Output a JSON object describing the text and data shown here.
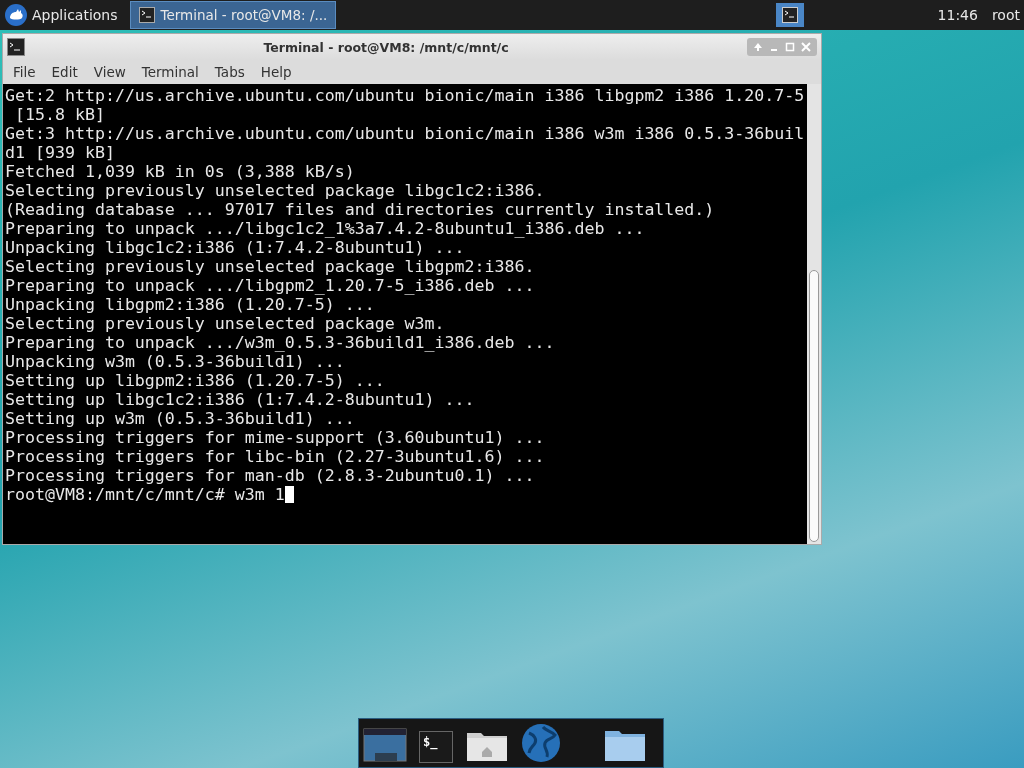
{
  "top_panel": {
    "menu_label": "Applications",
    "tasks": [
      {
        "title": "Terminal - root@VM8: /...",
        "selected": true
      }
    ],
    "workspaces": [
      {
        "selected": true
      }
    ],
    "clock": "11:46",
    "user": "root"
  },
  "window": {
    "title": "Terminal - root@VM8: /mnt/c/mnt/c",
    "menu": [
      "File",
      "Edit",
      "View",
      "Terminal",
      "Tabs",
      "Help"
    ],
    "lines": [
      "Get:2 http://us.archive.ubuntu.com/ubuntu bionic/main i386 libgpm2 i386 1.20.7-5",
      " [15.8 kB]",
      "Get:3 http://us.archive.ubuntu.com/ubuntu bionic/main i386 w3m i386 0.5.3-36buil",
      "d1 [939 kB]",
      "Fetched 1,039 kB in 0s (3,388 kB/s)",
      "Selecting previously unselected package libgc1c2:i386.",
      "(Reading database ... 97017 files and directories currently installed.)",
      "Preparing to unpack .../libgc1c2_1%3a7.4.2-8ubuntu1_i386.deb ...",
      "Unpacking libgc1c2:i386 (1:7.4.2-8ubuntu1) ...",
      "Selecting previously unselected package libgpm2:i386.",
      "Preparing to unpack .../libgpm2_1.20.7-5_i386.deb ...",
      "Unpacking libgpm2:i386 (1.20.7-5) ...",
      "Selecting previously unselected package w3m.",
      "Preparing to unpack .../w3m_0.5.3-36build1_i386.deb ...",
      "Unpacking w3m (0.5.3-36build1) ...",
      "Setting up libgpm2:i386 (1.20.7-5) ...",
      "Setting up libgc1c2:i386 (1:7.4.2-8ubuntu1) ...",
      "Setting up w3m (0.5.3-36build1) ...",
      "Processing triggers for mime-support (3.60ubuntu1) ...",
      "Processing triggers for libc-bin (2.27-3ubuntu1.6) ...",
      "Processing triggers for man-db (2.8.3-2ubuntu0.1) ...",
      "root@VM8:/mnt/c/mnt/c# w3m 1"
    ]
  },
  "dock": {
    "items": [
      {
        "kind": "monitor"
      },
      {
        "kind": "terminal",
        "glyph": "$_"
      },
      {
        "kind": "home-folder"
      },
      {
        "kind": "globe"
      },
      {
        "kind": "folder"
      }
    ]
  }
}
